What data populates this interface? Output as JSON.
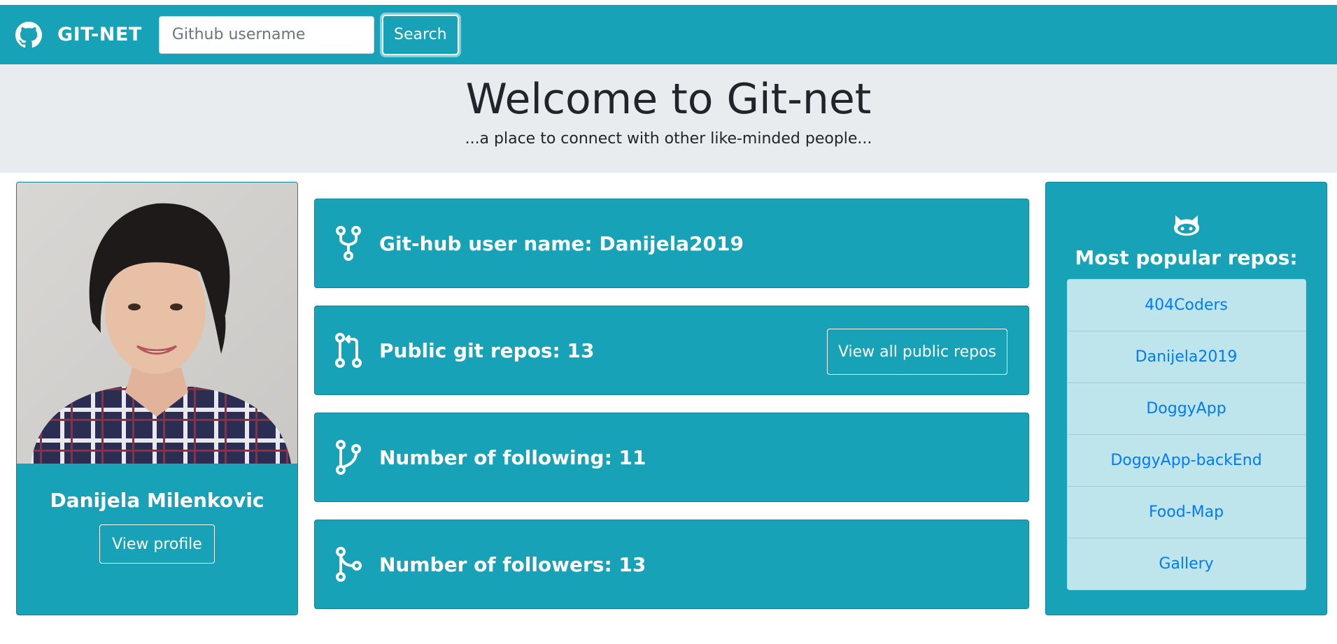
{
  "navbar": {
    "brand": "GIT-NET",
    "search_placeholder": "Github username",
    "search_button": "Search",
    "brand_icon": "github-icon"
  },
  "jumbotron": {
    "title": "Welcome to Git-net",
    "subtitle": "...a place to connect with other like-minded people..."
  },
  "profile": {
    "name": "Danijela Milenkovic",
    "view_profile": "View profile"
  },
  "stats": {
    "username": "Git-hub user name: Danijela2019",
    "public_repos": "Public git repos: 13",
    "view_all_repos": "View all public repos",
    "following": "Number of following: 11",
    "followers": "Number of followers: 13"
  },
  "popular": {
    "title": "Most popular repos:",
    "icon": "octocat-icon",
    "repos": [
      "404Coders",
      "Danijela2019",
      "DoggyApp",
      "DoggyApp-backEnd",
      "Food-Map",
      "Gallery"
    ]
  },
  "colors": {
    "primary": "#17a2b8",
    "jumbotron": "#e9ecef",
    "list_bg": "#bee5eb",
    "link": "#007bff"
  }
}
